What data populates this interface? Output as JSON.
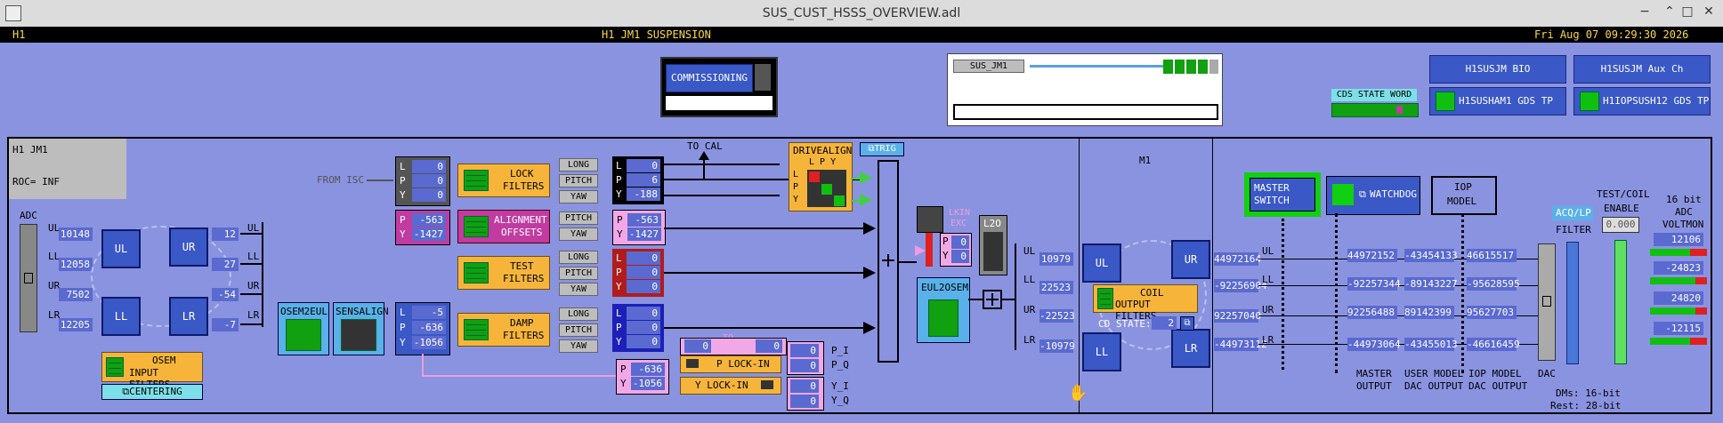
{
  "window": {
    "title": "SUS_CUST_HSSS_OVERVIEW.adl"
  },
  "header": {
    "site": "H1",
    "system": "H1 JM1 SUSPENSION",
    "datetime": "Fri Aug 07 09:29:30 2026"
  },
  "commissioning": {
    "label": "COMMISSIONING"
  },
  "guardian": {
    "name": "SUS_JM1"
  },
  "cds": {
    "label": "CDS STATE WORD"
  },
  "links": {
    "bio": "H1SUSJM BIO",
    "aux": "H1SUSJM Aux Ch",
    "gds1": "H1SUSHAM1 GDS TP",
    "gds2": "H1IOPSUSH12 GDS TP"
  },
  "panel": {
    "name": "H1   JM1",
    "roc": "ROC= INF"
  },
  "adc": {
    "label": "ADC",
    "rows": [
      {
        "name": "UL",
        "value": "10148"
      },
      {
        "name": "LL",
        "value": "12058"
      },
      {
        "name": "UR",
        "value": "7502"
      },
      {
        "name": "LR",
        "value": "12205"
      }
    ]
  },
  "osem": {
    "UL": "UL",
    "UR": "UR",
    "LL": "LL",
    "LR": "LR"
  },
  "osem_values": {
    "right": [
      "12",
      "27",
      "-54",
      "-7"
    ],
    "right_labels": [
      "UL",
      "LL",
      "UR",
      "LR"
    ]
  },
  "osem_input": {
    "label1": "OSEM",
    "label2": "INPUT FILTERS",
    "centering": "CENTERING"
  },
  "osem2eul": {
    "label": "OSEM2EUL"
  },
  "sensalign": {
    "label": "SENSALIGN"
  },
  "from_isc": {
    "label": "FROM ISC"
  },
  "to_cal": {
    "label": "TO CAL"
  },
  "isc": {
    "L": "0",
    "P": "0",
    "Y": "0"
  },
  "align_in": {
    "P": "-563",
    "Y": "-1427"
  },
  "eul": {
    "L": "-5",
    "P": "-636",
    "Y": "-1056"
  },
  "filters": {
    "lock": [
      "LOCK",
      "FILTERS"
    ],
    "align": [
      "ALIGNMENT",
      "OFFSETS"
    ],
    "test": [
      "TEST",
      "FILTERS"
    ],
    "damp": [
      "DAMP",
      "FILTERS"
    ]
  },
  "dof": {
    "long": "LONG",
    "pitch": "PITCH",
    "yaw": "YAW"
  },
  "lock_out": {
    "L": "0",
    "P": "6",
    "Y": "-188"
  },
  "align_out": {
    "P": "-563",
    "Y": "-1427"
  },
  "test_out": {
    "L": "0",
    "P": "0",
    "Y": "0"
  },
  "damp_out": {
    "L": "0",
    "P": "0",
    "Y": "0"
  },
  "lockin": {
    "p": "P LOCK-IN",
    "y": "Y LOCK-IN",
    "to_exc": "TO EXC",
    "in1": "0",
    "in2": "0",
    "p_i": "0",
    "p_q": "0",
    "y_i": "0",
    "y_q": "0",
    "p_i_lbl": "P_I",
    "p_q_lbl": "P_Q",
    "y_i_lbl": "Y_I",
    "y_q_lbl": "Y_Q",
    "P": "-636",
    "Y": "-1056"
  },
  "drivealign": {
    "label": "DRIVEALIGN",
    "cols": "L P Y",
    "rows": [
      "L",
      "P",
      "Y"
    ]
  },
  "trig": {
    "label": "TRIG"
  },
  "lkin_exc": {
    "label1": "LKIN",
    "label2": "EXC",
    "P": "0",
    "Y": "0"
  },
  "l2o": {
    "label": "L2O"
  },
  "eul2osem": {
    "label": "EUL2OSEM"
  },
  "coil_vals": [
    {
      "name": "UL",
      "value": "10979"
    },
    {
      "name": "LL",
      "value": "22523"
    },
    {
      "name": "UR",
      "value": "-22523"
    },
    {
      "name": "LR",
      "value": "-10979"
    }
  ],
  "m1": {
    "label": "M1"
  },
  "coil": {
    "label1": "COIL",
    "label2": "OUTPUT FILTERS",
    "cd_state_label": "CD STATE:",
    "cd_state": "2"
  },
  "coil_out": [
    {
      "name": "UL",
      "value": "44972164"
    },
    {
      "name": "LL",
      "value": "-92256904"
    },
    {
      "name": "UR",
      "value": "92257040"
    },
    {
      "name": "LR",
      "value": "-44973112"
    }
  ],
  "master": {
    "label1": "MASTER",
    "label2": "SWITCH"
  },
  "watchdog": {
    "label": "WATCHDOG"
  },
  "iop": {
    "label1": "IOP",
    "label2": "MODEL"
  },
  "master_out": [
    "44972152",
    "-92257344",
    "92256488",
    "-44973064"
  ],
  "user_dac": [
    "-43454133",
    "-89143227",
    "89142399",
    "-43455013"
  ],
  "iop_dac": [
    "46615517",
    "-95628595",
    "95627703",
    "-46616459"
  ],
  "columns": {
    "master": [
      "MASTER",
      "OUTPUT"
    ],
    "user": [
      "USER MODEL",
      "DAC OUTPUT"
    ],
    "iop": [
      "IOP MODEL",
      "DAC OUTPUT"
    ],
    "dac": "DAC"
  },
  "filter_ctrl": {
    "aco": "ACQ",
    "lp": "LP",
    "filter": "FILTER"
  },
  "test_coil": {
    "label1": "TEST/COIL",
    "label2": "ENABLE",
    "value": "0.000"
  },
  "voltmon": {
    "label1": "16 bit",
    "label2": "ADC",
    "label3": "VOLTMON",
    "values": [
      "12106",
      "-24823",
      "24820",
      "-12115"
    ]
  },
  "footer": {
    "line1": "DMs: 16-bit",
    "line2": "Rest: 28-bit"
  },
  "colors": {
    "background": "#8a93e0",
    "numeric_field": "#5a6ad0",
    "filter_yellow": "#f6b53a",
    "pink": "#f2a8e6"
  }
}
